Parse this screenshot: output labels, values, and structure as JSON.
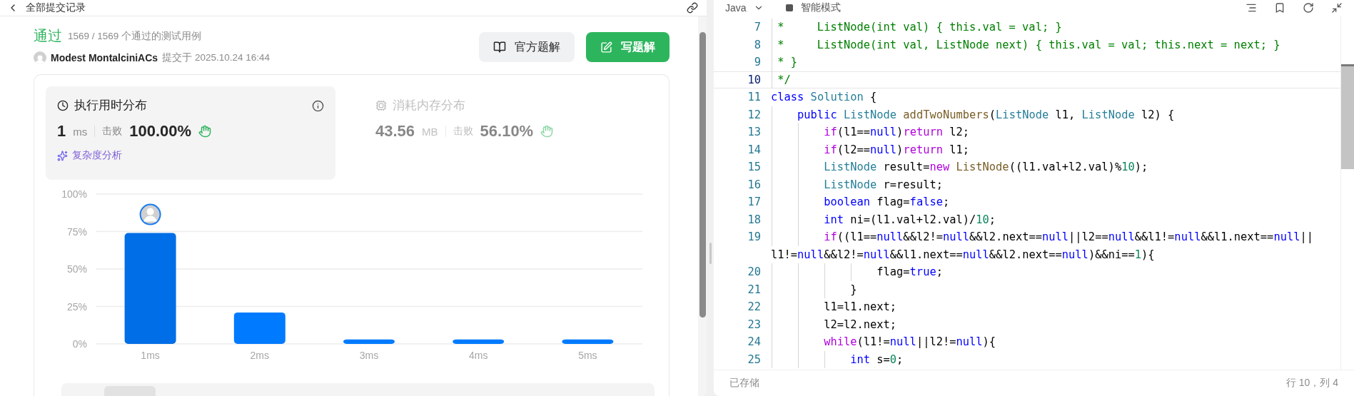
{
  "left_panel": {
    "title": "全部提交记录",
    "result": {
      "status": "通过",
      "cases": "1569 / 1569 个通过的测试用例",
      "author": "Modest MontalciniACs",
      "submitted": "提交于 2025.10.24 16:44"
    },
    "buttons": [
      {
        "kind": "secondary",
        "label": "官方题解"
      },
      {
        "kind": "primary",
        "label": "写题解"
      }
    ],
    "metrics": [
      {
        "kind": "time",
        "title": "执行用时分布",
        "value": "1",
        "unit": "ms",
        "beat_label": "击败",
        "beat": "100.00%",
        "selected": true,
        "link": "复杂度分析"
      },
      {
        "kind": "memory",
        "title": "消耗内存分布",
        "value": "43.56",
        "unit": "MB",
        "beat_label": "击败",
        "beat": "56.10%",
        "selected": false
      }
    ],
    "chart_data": {
      "type": "bar",
      "categories": [
        "1ms",
        "2ms",
        "3ms",
        "4ms",
        "5ms"
      ],
      "stacked": true,
      "grid": true,
      "series": [
        {
          "color": "#006ee6",
          "values": [
            74,
            null,
            null,
            null,
            null
          ]
        },
        {
          "color": "#007bff",
          "values": [
            null,
            21,
            3,
            3,
            3
          ]
        }
      ],
      "ylim": [
        0,
        100
      ],
      "yticks": [
        {
          "value": 0,
          "label": "0%"
        },
        {
          "value": 25,
          "label": "25%"
        },
        {
          "value": 50,
          "label": "50%"
        },
        {
          "value": 75,
          "label": "75%"
        },
        {
          "value": 100,
          "label": "100%"
        }
      ]
    }
  },
  "editor": {
    "language": "Java",
    "mode": "智能模式",
    "lines": [
      {
        "n": "7",
        "active": false,
        "tokens": [
          {
            "kind": "comment",
            "t": " *     ListNode(int val) { this.val = val; }"
          }
        ]
      },
      {
        "n": "8",
        "active": false,
        "tokens": [
          {
            "kind": "comment",
            "t": " *     ListNode(int val, ListNode next) { this.val = val; this.next = next; }"
          }
        ]
      },
      {
        "n": "9",
        "active": false,
        "tokens": [
          {
            "kind": "comment",
            "t": " * }"
          }
        ]
      },
      {
        "n": "10",
        "active": true,
        "tokens": [
          {
            "kind": "comment",
            "t": " */"
          }
        ]
      },
      {
        "n": "11",
        "active": false,
        "tokens": [
          {
            "kind": "keyword",
            "t": "class "
          },
          {
            "kind": "typename",
            "t": "Solution"
          },
          {
            "kind": "plain",
            "t": " {"
          }
        ]
      },
      {
        "n": "12",
        "active": false,
        "tokens": [
          {
            "kind": "keyword",
            "t": "    public "
          },
          {
            "kind": "typename",
            "t": "ListNode "
          },
          {
            "kind": "function",
            "t": "addTwoNumbers"
          },
          {
            "kind": "plain",
            "t": "("
          },
          {
            "kind": "typename",
            "t": "ListNode"
          },
          {
            "kind": "plain",
            "t": " l1, "
          },
          {
            "kind": "typename",
            "t": "ListNode"
          },
          {
            "kind": "plain",
            "t": " l2) {"
          }
        ]
      },
      {
        "n": "13",
        "active": false,
        "tokens": [
          {
            "kind": "control",
            "t": "        if"
          },
          {
            "kind": "plain",
            "t": "(l1=="
          },
          {
            "kind": "keyword",
            "t": "null"
          },
          {
            "kind": "plain",
            "t": ")"
          },
          {
            "kind": "control",
            "t": "return"
          },
          {
            "kind": "plain",
            "t": " l2;"
          }
        ]
      },
      {
        "n": "14",
        "active": false,
        "tokens": [
          {
            "kind": "control",
            "t": "        if"
          },
          {
            "kind": "plain",
            "t": "(l2=="
          },
          {
            "kind": "keyword",
            "t": "null"
          },
          {
            "kind": "plain",
            "t": ")"
          },
          {
            "kind": "control",
            "t": "return"
          },
          {
            "kind": "plain",
            "t": " l1;"
          }
        ]
      },
      {
        "n": "15",
        "active": false,
        "tokens": [
          {
            "kind": "typename",
            "t": "        ListNode"
          },
          {
            "kind": "plain",
            "t": " result="
          },
          {
            "kind": "control",
            "t": "new "
          },
          {
            "kind": "function",
            "t": "ListNode"
          },
          {
            "kind": "plain",
            "t": "((l1.val+l2.val)%"
          },
          {
            "kind": "number",
            "t": "10"
          },
          {
            "kind": "plain",
            "t": ");"
          }
        ]
      },
      {
        "n": "16",
        "active": false,
        "tokens": [
          {
            "kind": "typename",
            "t": "        ListNode"
          },
          {
            "kind": "plain",
            "t": " r=result;"
          }
        ]
      },
      {
        "n": "17",
        "active": false,
        "tokens": [
          {
            "kind": "keyword",
            "t": "        boolean"
          },
          {
            "kind": "plain",
            "t": " flag="
          },
          {
            "kind": "keyword",
            "t": "false"
          },
          {
            "kind": "plain",
            "t": ";"
          }
        ]
      },
      {
        "n": "18",
        "active": false,
        "tokens": [
          {
            "kind": "keyword",
            "t": "        int"
          },
          {
            "kind": "plain",
            "t": " ni=(l1.val+l2.val)/"
          },
          {
            "kind": "number",
            "t": "10"
          },
          {
            "kind": "plain",
            "t": ";"
          }
        ]
      },
      {
        "n": "19",
        "active": false,
        "tokens": [
          {
            "kind": "control",
            "t": "        if"
          },
          {
            "kind": "plain",
            "t": "((l1=="
          },
          {
            "kind": "keyword",
            "t": "null"
          },
          {
            "kind": "plain",
            "t": "&&l2!="
          },
          {
            "kind": "keyword",
            "t": "null"
          },
          {
            "kind": "plain",
            "t": "&&l2.next=="
          },
          {
            "kind": "keyword",
            "t": "null"
          },
          {
            "kind": "plain",
            "t": "||l2=="
          },
          {
            "kind": "keyword",
            "t": "null"
          },
          {
            "kind": "plain",
            "t": "&&l1!="
          },
          {
            "kind": "keyword",
            "t": "null"
          },
          {
            "kind": "plain",
            "t": "&&l1.next=="
          },
          {
            "kind": "keyword",
            "t": "null"
          },
          {
            "kind": "plain",
            "t": "||"
          }
        ]
      },
      {
        "active": false,
        "tokens": [
          {
            "kind": "plain",
            "t": "l1!="
          },
          {
            "kind": "keyword",
            "t": "null"
          },
          {
            "kind": "plain",
            "t": "&&l2!="
          },
          {
            "kind": "keyword",
            "t": "null"
          },
          {
            "kind": "plain",
            "t": "&&l1.next=="
          },
          {
            "kind": "keyword",
            "t": "null"
          },
          {
            "kind": "plain",
            "t": "&&l2.next=="
          },
          {
            "kind": "keyword",
            "t": "null"
          },
          {
            "kind": "plain",
            "t": ")&&ni=="
          },
          {
            "kind": "number",
            "t": "1"
          },
          {
            "kind": "plain",
            "t": "){"
          }
        ]
      },
      {
        "n": "20",
        "active": false,
        "tokens": [
          {
            "kind": "plain",
            "t": "                flag="
          },
          {
            "kind": "keyword",
            "t": "true"
          },
          {
            "kind": "plain",
            "t": ";"
          }
        ]
      },
      {
        "n": "21",
        "active": false,
        "tokens": [
          {
            "kind": "plain",
            "t": "            }"
          }
        ]
      },
      {
        "n": "22",
        "active": false,
        "tokens": [
          {
            "kind": "plain",
            "t": "        l1=l1.next;"
          }
        ]
      },
      {
        "n": "23",
        "active": false,
        "tokens": [
          {
            "kind": "plain",
            "t": "        l2=l2.next;"
          }
        ]
      },
      {
        "n": "24",
        "active": false,
        "tokens": [
          {
            "kind": "control",
            "t": "        while"
          },
          {
            "kind": "plain",
            "t": "(l1!="
          },
          {
            "kind": "keyword",
            "t": "null"
          },
          {
            "kind": "plain",
            "t": "||l2!="
          },
          {
            "kind": "keyword",
            "t": "null"
          },
          {
            "kind": "plain",
            "t": "){"
          }
        ]
      },
      {
        "n": "25",
        "active": false,
        "tokens": [
          {
            "kind": "keyword",
            "t": "            int"
          },
          {
            "kind": "plain",
            "t": " s="
          },
          {
            "kind": "number",
            "t": "0"
          },
          {
            "kind": "plain",
            "t": ";"
          }
        ]
      }
    ],
    "status": {
      "saved": "已存储",
      "cursor": "行 10，列 4"
    }
  }
}
